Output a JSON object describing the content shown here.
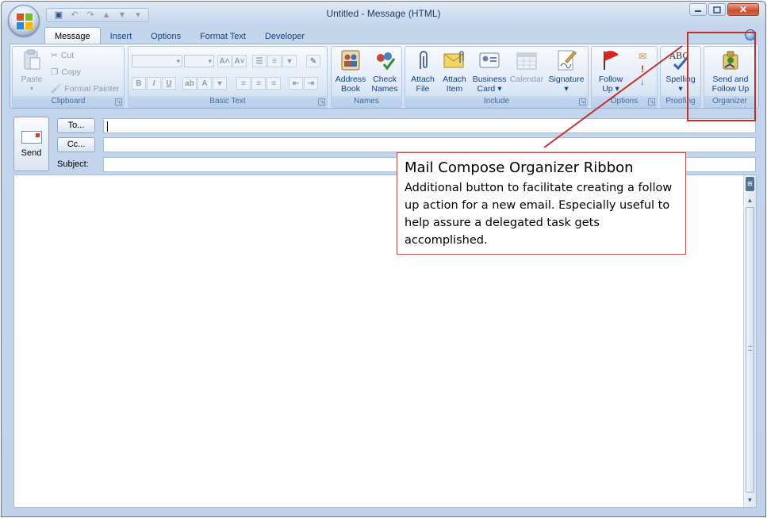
{
  "window": {
    "title": "Untitled - Message (HTML)"
  },
  "tabs": [
    {
      "label": "Message",
      "active": true
    },
    {
      "label": "Insert",
      "active": false
    },
    {
      "label": "Options",
      "active": false
    },
    {
      "label": "Format Text",
      "active": false
    },
    {
      "label": "Developer",
      "active": false
    }
  ],
  "ribbon": {
    "clipboard": {
      "label": "Clipboard",
      "paste": "Paste",
      "cut": "Cut",
      "copy": "Copy",
      "format_painter": "Format Painter"
    },
    "basic_text": {
      "label": "Basic Text"
    },
    "names": {
      "label": "Names",
      "address_book": "Address\nBook",
      "check_names": "Check\nNames"
    },
    "include": {
      "label": "Include",
      "attach_file": "Attach\nFile",
      "attach_item": "Attach\nItem",
      "business_card": "Business\nCard ▾",
      "calendar": "Calendar",
      "signature": "Signature\n▾"
    },
    "options": {
      "label": "Options",
      "follow_up": "Follow\nUp ▾"
    },
    "proofing": {
      "label": "Proofing",
      "spelling": "Spelling\n▾"
    },
    "organizer": {
      "label": "Organizer",
      "send_follow_up": "Send and\nFollow Up"
    }
  },
  "compose": {
    "send": "Send",
    "to": "To...",
    "cc": "Cc...",
    "subject_label": "Subject:"
  },
  "annotation": {
    "title": "Mail Compose Organizer Ribbon",
    "body": "Additional button to facilitate creating a follow up action for a new email.  Especially useful to help assure a delegated task gets accomplished."
  },
  "colors": {
    "annotation_red": "#c0312b",
    "ribbon_text": "#15428b"
  }
}
